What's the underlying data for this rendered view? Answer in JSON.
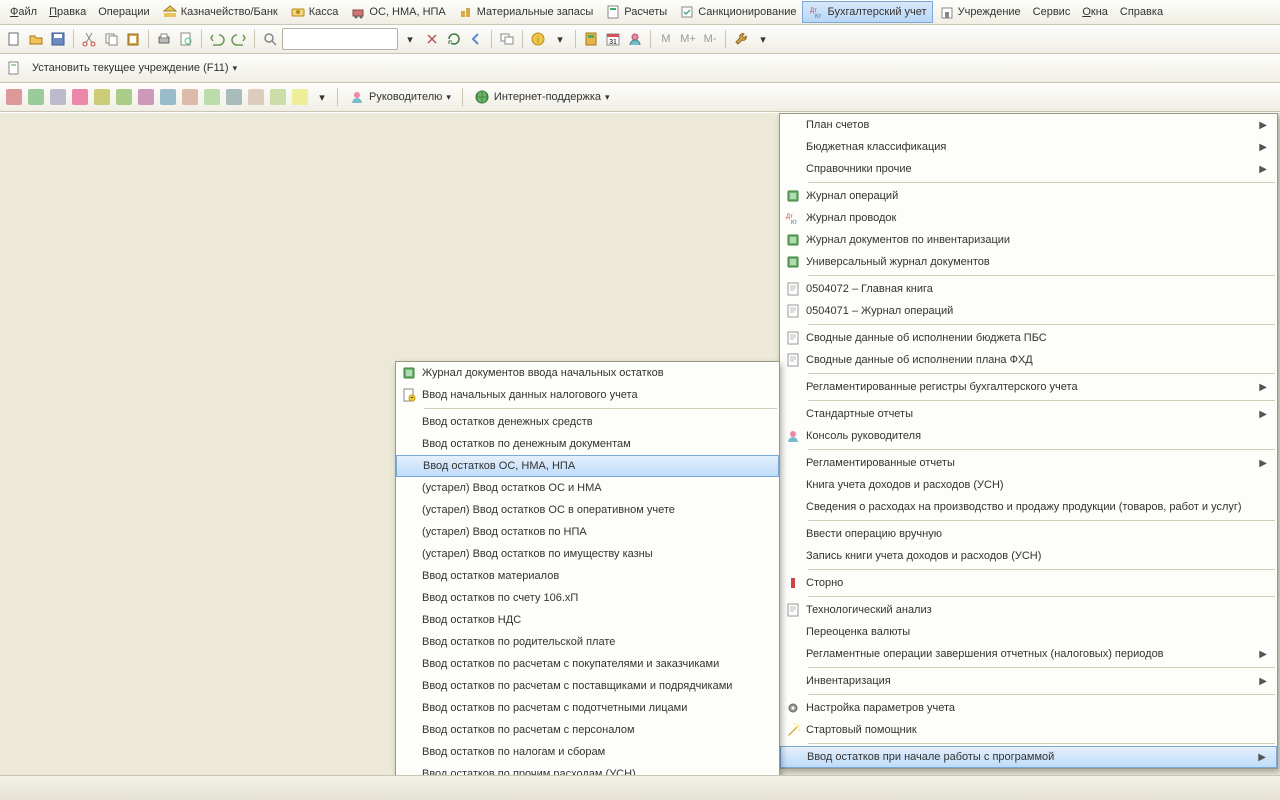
{
  "menubar": [
    {
      "label": "Файл",
      "u": 0,
      "icon": ""
    },
    {
      "label": "Правка",
      "u": 0,
      "icon": ""
    },
    {
      "label": "Операции",
      "u": -1,
      "icon": ""
    },
    {
      "label": "Казначейство/Банк",
      "u": -1,
      "icon": "bank"
    },
    {
      "label": "Касса",
      "u": -1,
      "icon": "cash"
    },
    {
      "label": "ОС, НМА, НПА",
      "u": -1,
      "icon": "os"
    },
    {
      "label": "Материальные запасы",
      "u": -1,
      "icon": "mat"
    },
    {
      "label": "Расчеты",
      "u": -1,
      "icon": "calc"
    },
    {
      "label": "Санкционирование",
      "u": -1,
      "icon": "sanc"
    },
    {
      "label": "Бухгалтерский учет",
      "u": -1,
      "icon": "acc",
      "open": true
    },
    {
      "label": "Учреждение",
      "u": -1,
      "icon": "org"
    },
    {
      "label": "Сервис",
      "u": -1,
      "icon": ""
    },
    {
      "label": "Окна",
      "u": 0,
      "icon": ""
    },
    {
      "label": "Справка",
      "u": -1,
      "icon": ""
    }
  ],
  "toolbar2_text": "Установить текущее учреждение (F11)",
  "toolbar3": {
    "leader": "Руководителю",
    "support": "Интернет-поддержка"
  },
  "main_menu": [
    {
      "t": "План счетов",
      "arr": true
    },
    {
      "t": "Бюджетная классификация",
      "arr": true
    },
    {
      "t": "Справочники прочие",
      "arr": true
    },
    {
      "sep": true
    },
    {
      "t": "Журнал операций",
      "icon": "journal-green"
    },
    {
      "t": "Журнал проводок",
      "icon": "dtkt"
    },
    {
      "t": "Журнал документов по инвентаризации",
      "icon": "journal-green"
    },
    {
      "t": "Универсальный журнал документов",
      "icon": "journal-green"
    },
    {
      "sep": true
    },
    {
      "t": "0504072  –  Главная книга",
      "icon": "report"
    },
    {
      "t": "0504071  –  Журнал операций",
      "icon": "report"
    },
    {
      "sep": true
    },
    {
      "t": "Сводные данные об исполнении бюджета ПБС",
      "icon": "report"
    },
    {
      "t": "Сводные данные об исполнении плана ФХД",
      "icon": "report"
    },
    {
      "sep": true
    },
    {
      "t": "Регламентированные регистры бухгалтерского учета",
      "arr": true
    },
    {
      "sep": true
    },
    {
      "t": "Стандартные отчеты",
      "arr": true
    },
    {
      "t": "Консоль руководителя",
      "icon": "leader"
    },
    {
      "sep": true
    },
    {
      "t": "Регламентированные отчеты",
      "arr": true
    },
    {
      "t": "Книга учета доходов и расходов (УСН)"
    },
    {
      "t": "Сведения о расходах на производство и продажу продукции (товаров, работ и услуг)"
    },
    {
      "sep": true
    },
    {
      "t": "Ввести операцию вручную"
    },
    {
      "t": "Запись книги учета доходов и расходов (УСН)"
    },
    {
      "sep": true
    },
    {
      "t": "Сторно",
      "icon": "storno"
    },
    {
      "sep": true
    },
    {
      "t": "Технологический анализ",
      "icon": "report"
    },
    {
      "t": "Переоценка валюты"
    },
    {
      "t": "Регламентные операции завершения отчетных (налоговых) периодов",
      "arr": true
    },
    {
      "sep": true
    },
    {
      "t": "Инвентаризация",
      "arr": true
    },
    {
      "sep": true
    },
    {
      "t": "Настройка параметров учета",
      "icon": "gear"
    },
    {
      "t": "Стартовый помощник",
      "icon": "wizard"
    },
    {
      "sep": true
    },
    {
      "t": "Ввод остатков при начале работы с программой",
      "arr": true,
      "sel": true
    }
  ],
  "sub_menu": [
    {
      "t": "Журнал документов ввода начальных остатков",
      "icon": "journal-green"
    },
    {
      "t": "Ввод начальных данных налогового учета",
      "icon": "doc-new"
    },
    {
      "sep": true
    },
    {
      "t": "Ввод остатков денежных средств"
    },
    {
      "t": "Ввод остатков по денежным документам"
    },
    {
      "t": "Ввод остатков ОС, НМА, НПА",
      "sel": true
    },
    {
      "t": "(устарел) Ввод остатков ОС и НМА"
    },
    {
      "t": "(устарел) Ввод остатков ОС в оперативном учете"
    },
    {
      "t": "(устарел) Ввод остатков по НПА"
    },
    {
      "t": "(устарел) Ввод остатков по имуществу казны"
    },
    {
      "t": "Ввод остатков материалов"
    },
    {
      "t": "Ввод остатков по счету 106.хП"
    },
    {
      "t": "Ввод остатков НДС"
    },
    {
      "t": "Ввод остатков по родительской плате"
    },
    {
      "t": "Ввод остатков по расчетам с покупателями и заказчиками"
    },
    {
      "t": "Ввод остатков по расчетам с поставщиками и подрядчиками"
    },
    {
      "t": "Ввод остатков по расчетам с подотчетными лицами"
    },
    {
      "t": "Ввод остатков по расчетам с персоналом"
    },
    {
      "t": "Ввод остатков по налогам и сборам"
    },
    {
      "t": "Ввод остатков по прочим расходам (УСН)"
    }
  ]
}
